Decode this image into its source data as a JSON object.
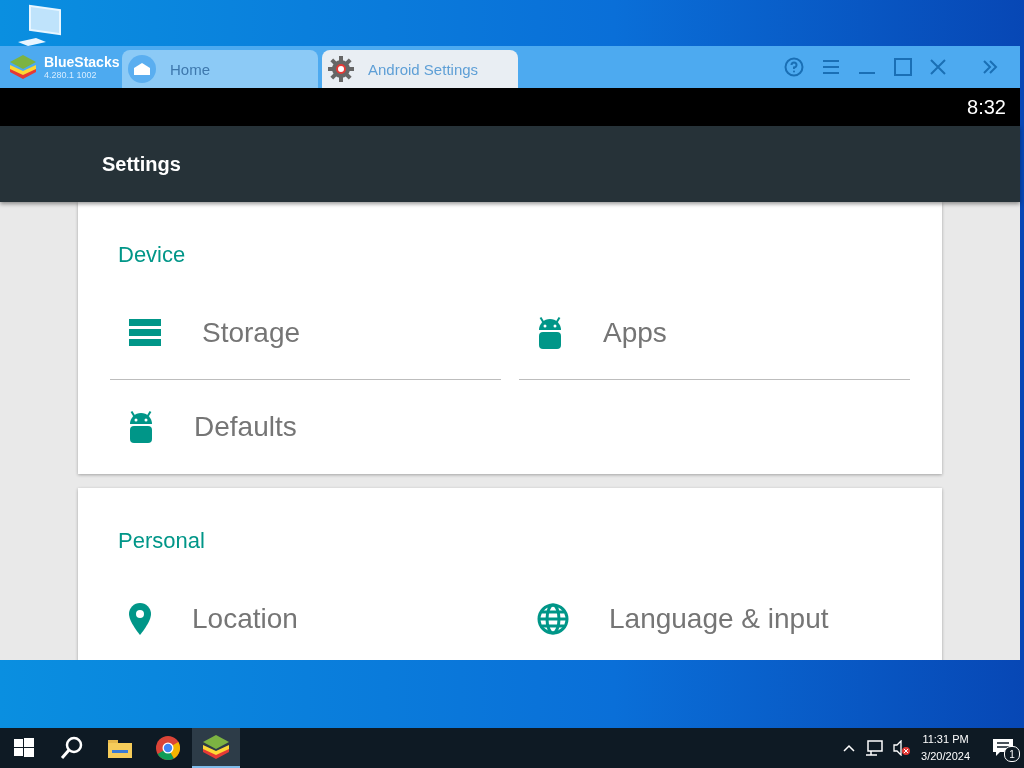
{
  "app": {
    "name": "BlueStacks",
    "version": "4.280.1 1002"
  },
  "tabs": [
    {
      "label": "Home",
      "kind": "home",
      "selected": false
    },
    {
      "label": "Android Settings",
      "kind": "gear",
      "selected": true
    }
  ],
  "status_bar": {
    "time": "8:32"
  },
  "toolbar": {
    "title": "Settings"
  },
  "sections": [
    {
      "title": "Device",
      "items": [
        {
          "label": "Storage",
          "kind": "storage"
        },
        {
          "label": "Apps",
          "kind": "android"
        },
        {
          "label": "Defaults",
          "kind": "android"
        }
      ]
    },
    {
      "title": "Personal",
      "items": [
        {
          "label": "Location",
          "kind": "location"
        },
        {
          "label": "Language & input",
          "kind": "globe"
        }
      ]
    }
  ],
  "taskbar": {
    "time": "11:31 PM",
    "date": "3/20/2024",
    "notifications": "1"
  }
}
